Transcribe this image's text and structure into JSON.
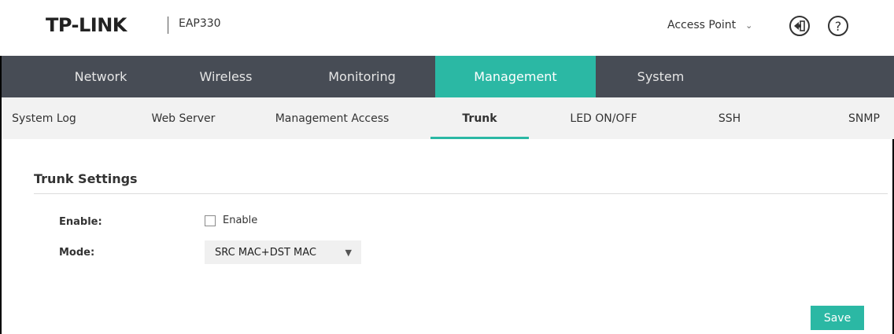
{
  "header": {
    "logo": "TP-LINK",
    "model": "EAP330",
    "mode_select": "Access Point",
    "mode_chevron_icon": "chevron-down-icon",
    "logout_icon": "logout-icon",
    "help_icon": "help-icon",
    "help_glyph": "?"
  },
  "main_nav": {
    "items": [
      {
        "label": "Network"
      },
      {
        "label": "Wireless"
      },
      {
        "label": "Monitoring"
      },
      {
        "label": "Management"
      },
      {
        "label": "System"
      }
    ],
    "active": "Management"
  },
  "sub_nav": {
    "items": [
      {
        "label": "System Log"
      },
      {
        "label": "Web Server"
      },
      {
        "label": "Management Access"
      },
      {
        "label": "Trunk"
      },
      {
        "label": "LED ON/OFF"
      },
      {
        "label": "SSH"
      },
      {
        "label": "SNMP"
      }
    ],
    "active": "Trunk"
  },
  "trunk": {
    "title": "Trunk Settings",
    "enable_label": "Enable:",
    "enable_checkbox_label": "Enable",
    "enable_checked": false,
    "mode_label": "Mode:",
    "mode_value": "SRC MAC+DST MAC"
  },
  "actions": {
    "save_label": "Save"
  },
  "colors": {
    "accent": "#2bb8a4",
    "nav_bg": "#474c55",
    "subnav_bg": "#f2f2f2"
  }
}
